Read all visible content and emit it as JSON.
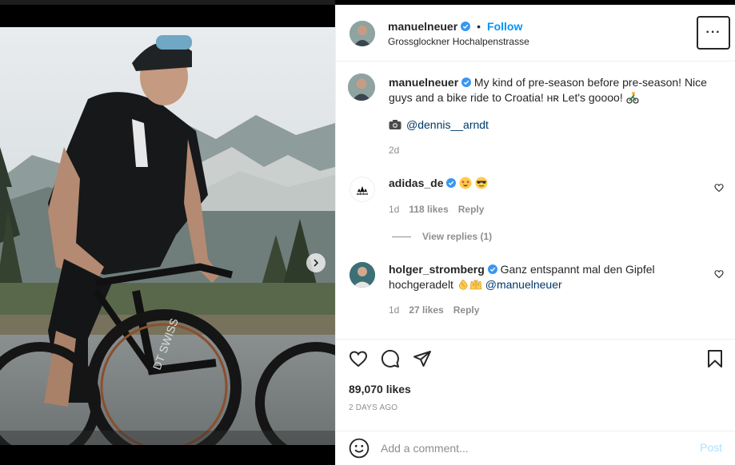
{
  "post": {
    "username": "manuelneuer",
    "follow_label": "Follow",
    "location": "Grossglockner Hochalpenstrasse",
    "more_label": "···",
    "caption": {
      "username": "manuelneuer",
      "text": "My kind of pre-season before pre-season! Nice guys and a bike ride to Croatia! ʜʀ Let's goooo!",
      "credit_mention": "@dennis__arndt",
      "time": "2d"
    },
    "comments": [
      {
        "username": "adidas_de",
        "text": "",
        "time": "1d",
        "likes": "118 likes",
        "reply_label": "Reply"
      },
      {
        "username": "holger_stromberg",
        "text": "Ganz entspannt mal den Gipfel hochgeradelt",
        "mention": "@manuelneuer",
        "time": "1d",
        "likes": "27 likes",
        "reply_label": "Reply"
      }
    ],
    "view_replies": "View replies (1)",
    "likes": "89,070 likes",
    "date": "2 DAYS AGO",
    "add_comment_placeholder": "Add a comment...",
    "post_label": "Post",
    "carousel": {
      "slides": 5,
      "active": 1
    }
  },
  "colors": {
    "accent": "#0095f6",
    "text": "#262626",
    "muted": "#8e8e8e",
    "link": "#00376b",
    "post_disabled": "#b2dffc"
  },
  "icons": {
    "verified": "verified-badge-icon",
    "like": "heart-icon",
    "comment": "comment-bubble-icon",
    "share": "paper-plane-icon",
    "save": "bookmark-icon",
    "emoji": "smiley-icon",
    "camera": "camera-icon",
    "next": "chevron-right-icon"
  }
}
